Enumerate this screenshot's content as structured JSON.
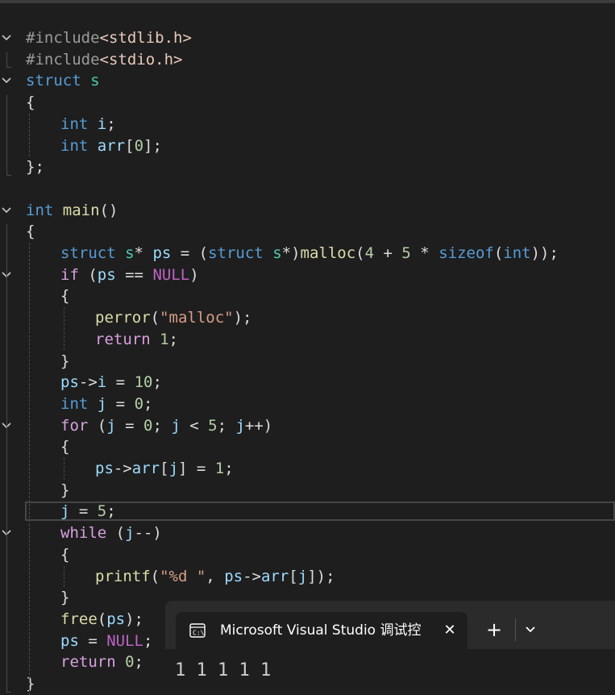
{
  "editor": {
    "lines": [
      {
        "fold": "open",
        "indent": 0,
        "tokens": [
          [
            "pp",
            "#include"
          ],
          [
            "inc",
            "<stdlib.h>"
          ]
        ]
      },
      {
        "fold": "",
        "indent": 0,
        "tokens": [
          [
            "pp",
            "#include"
          ],
          [
            "inc",
            "<stdio.h>"
          ]
        ]
      },
      {
        "fold": "open",
        "indent": 0,
        "tokens": [
          [
            "kw",
            "struct"
          ],
          [
            "pl",
            " "
          ],
          [
            "typ",
            "s"
          ]
        ]
      },
      {
        "fold": "",
        "indent": 0,
        "tokens": [
          [
            "pl",
            "{"
          ]
        ]
      },
      {
        "fold": "",
        "indent": 1,
        "tokens": [
          [
            "kw",
            "int"
          ],
          [
            "pl",
            " "
          ],
          [
            "var",
            "i"
          ],
          [
            "pl",
            ";"
          ]
        ]
      },
      {
        "fold": "",
        "indent": 1,
        "tokens": [
          [
            "kw",
            "int"
          ],
          [
            "pl",
            " "
          ],
          [
            "var",
            "arr"
          ],
          [
            "pl",
            "["
          ],
          [
            "num",
            "0"
          ],
          [
            "pl",
            "];"
          ]
        ]
      },
      {
        "fold": "",
        "indent": 0,
        "tokens": [
          [
            "pl",
            "};"
          ]
        ]
      },
      {
        "fold": "",
        "indent": 0,
        "tokens": []
      },
      {
        "fold": "open",
        "indent": 0,
        "tokens": [
          [
            "kw",
            "int"
          ],
          [
            "pl",
            " "
          ],
          [
            "fn",
            "main"
          ],
          [
            "pl",
            "()"
          ]
        ]
      },
      {
        "fold": "",
        "indent": 0,
        "tokens": [
          [
            "pl",
            "{"
          ]
        ]
      },
      {
        "fold": "",
        "indent": 1,
        "tokens": [
          [
            "kw",
            "struct"
          ],
          [
            "pl",
            " "
          ],
          [
            "typ",
            "s"
          ],
          [
            "pl",
            "* "
          ],
          [
            "var",
            "ps"
          ],
          [
            "pl",
            " = ("
          ],
          [
            "kw",
            "struct"
          ],
          [
            "pl",
            " "
          ],
          [
            "typ",
            "s"
          ],
          [
            "pl",
            "*)"
          ],
          [
            "fn",
            "malloc"
          ],
          [
            "pl",
            "("
          ],
          [
            "num",
            "4"
          ],
          [
            "pl",
            " + "
          ],
          [
            "num",
            "5"
          ],
          [
            "pl",
            " * "
          ],
          [
            "kw",
            "sizeof"
          ],
          [
            "pl",
            "("
          ],
          [
            "kw",
            "int"
          ],
          [
            "pl",
            "));"
          ]
        ]
      },
      {
        "fold": "open",
        "indent": 1,
        "tokens": [
          [
            "ctl",
            "if"
          ],
          [
            "pl",
            " ("
          ],
          [
            "var",
            "ps"
          ],
          [
            "pl",
            " == "
          ],
          [
            "mac",
            "NULL"
          ],
          [
            "pl",
            ")"
          ]
        ]
      },
      {
        "fold": "",
        "indent": 1,
        "tokens": [
          [
            "pl",
            "{"
          ]
        ]
      },
      {
        "fold": "",
        "indent": 2,
        "tokens": [
          [
            "fn",
            "perror"
          ],
          [
            "pl",
            "("
          ],
          [
            "str",
            "\"malloc\""
          ],
          [
            "pl",
            ");"
          ]
        ]
      },
      {
        "fold": "",
        "indent": 2,
        "tokens": [
          [
            "ctl",
            "return"
          ],
          [
            "pl",
            " "
          ],
          [
            "num",
            "1"
          ],
          [
            "pl",
            ";"
          ]
        ]
      },
      {
        "fold": "",
        "indent": 1,
        "tokens": [
          [
            "pl",
            "}"
          ]
        ]
      },
      {
        "fold": "",
        "indent": 1,
        "tokens": [
          [
            "var",
            "ps"
          ],
          [
            "pl",
            "->"
          ],
          [
            "var",
            "i"
          ],
          [
            "pl",
            " = "
          ],
          [
            "num",
            "10"
          ],
          [
            "pl",
            ";"
          ]
        ]
      },
      {
        "fold": "",
        "indent": 1,
        "tokens": [
          [
            "kw",
            "int"
          ],
          [
            "pl",
            " "
          ],
          [
            "var",
            "j"
          ],
          [
            "pl",
            " = "
          ],
          [
            "num",
            "0"
          ],
          [
            "pl",
            ";"
          ]
        ]
      },
      {
        "fold": "open",
        "indent": 1,
        "tokens": [
          [
            "ctl",
            "for"
          ],
          [
            "pl",
            " ("
          ],
          [
            "var",
            "j"
          ],
          [
            "pl",
            " = "
          ],
          [
            "num",
            "0"
          ],
          [
            "pl",
            "; "
          ],
          [
            "var",
            "j"
          ],
          [
            "pl",
            " < "
          ],
          [
            "num",
            "5"
          ],
          [
            "pl",
            "; "
          ],
          [
            "var",
            "j"
          ],
          [
            "pl",
            "++)"
          ]
        ]
      },
      {
        "fold": "",
        "indent": 1,
        "tokens": [
          [
            "pl",
            "{"
          ]
        ]
      },
      {
        "fold": "",
        "indent": 2,
        "tokens": [
          [
            "var",
            "ps"
          ],
          [
            "pl",
            "->"
          ],
          [
            "var",
            "arr"
          ],
          [
            "pl",
            "["
          ],
          [
            "var",
            "j"
          ],
          [
            "pl",
            "] = "
          ],
          [
            "num",
            "1"
          ],
          [
            "pl",
            ";"
          ]
        ]
      },
      {
        "fold": "",
        "indent": 1,
        "tokens": [
          [
            "pl",
            "}"
          ]
        ]
      },
      {
        "fold": "",
        "indent": 1,
        "tokens": [
          [
            "var",
            "j"
          ],
          [
            "pl",
            " = "
          ],
          [
            "num",
            "5"
          ],
          [
            "pl",
            ";"
          ]
        ]
      },
      {
        "fold": "open",
        "indent": 1,
        "tokens": [
          [
            "ctl",
            "while"
          ],
          [
            "pl",
            " ("
          ],
          [
            "var",
            "j"
          ],
          [
            "pl",
            "--)"
          ]
        ]
      },
      {
        "fold": "",
        "indent": 1,
        "tokens": [
          [
            "pl",
            "{"
          ]
        ]
      },
      {
        "fold": "",
        "indent": 2,
        "tokens": [
          [
            "fn",
            "printf"
          ],
          [
            "pl",
            "("
          ],
          [
            "str",
            "\"%d \""
          ],
          [
            "pl",
            ", "
          ],
          [
            "var",
            "ps"
          ],
          [
            "pl",
            "->"
          ],
          [
            "var",
            "arr"
          ],
          [
            "pl",
            "["
          ],
          [
            "var",
            "j"
          ],
          [
            "pl",
            "]);"
          ]
        ]
      },
      {
        "fold": "",
        "indent": 1,
        "tokens": [
          [
            "pl",
            "}"
          ]
        ]
      },
      {
        "fold": "",
        "indent": 1,
        "tokens": [
          [
            "fn",
            "free"
          ],
          [
            "pl",
            "("
          ],
          [
            "var",
            "ps"
          ],
          [
            "pl",
            ");"
          ]
        ]
      },
      {
        "fold": "",
        "indent": 1,
        "tokens": [
          [
            "var",
            "ps"
          ],
          [
            "pl",
            " = "
          ],
          [
            "mac",
            "NULL"
          ],
          [
            "pl",
            ";"
          ]
        ]
      },
      {
        "fold": "",
        "indent": 1,
        "tokens": [
          [
            "ctl",
            "return"
          ],
          [
            "pl",
            " "
          ],
          [
            "num",
            "0"
          ],
          [
            "pl",
            ";"
          ]
        ]
      },
      {
        "fold": "",
        "indent": 0,
        "tokens": [
          [
            "pl",
            "}"
          ]
        ]
      }
    ],
    "current_line": 22
  },
  "terminal": {
    "icon": "console-icon",
    "tab_title": "Microsoft Visual Studio 调试控",
    "close_glyph": "✕",
    "new_tab_glyph": "+",
    "output": "1 1 1 1 1"
  },
  "colors": {
    "background": "#1e1e1e",
    "keyword": "#569cd6",
    "control": "#d8a0df",
    "string": "#d69d85",
    "number": "#b5cea8",
    "type": "#4ec9b0",
    "function": "#dcdcaa",
    "variable": "#9cdcfe",
    "macro": "#bd63c5"
  }
}
